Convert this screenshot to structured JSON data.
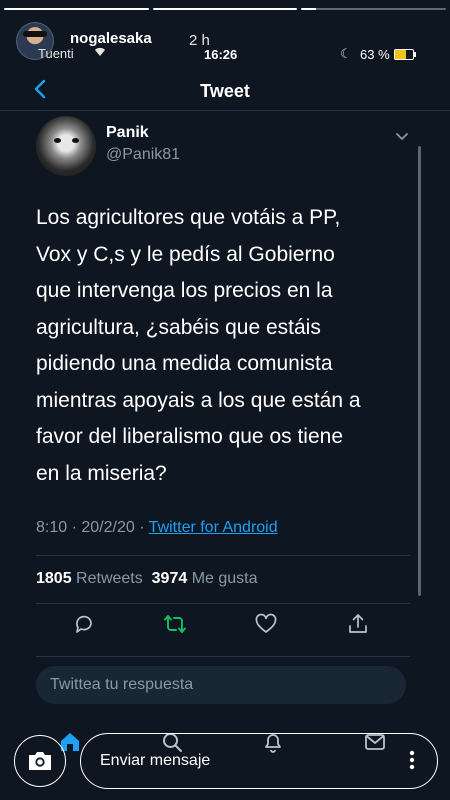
{
  "story": {
    "username": "nogalesaka",
    "time_ago": "2 h",
    "progress": [
      1,
      1,
      0.1
    ]
  },
  "statusbar": {
    "carrier": "Tuenti",
    "time": "16:26",
    "battery": "63 %",
    "battery_level": 0.63,
    "battery_color": "#f2c31b"
  },
  "nav": {
    "title": "Tweet"
  },
  "tweet": {
    "name": "Panik",
    "handle": "@Panik81",
    "text_lines": [
      "Los agricultores que votáis a PP,",
      "Vox y C,s y le pedís al Gobierno",
      "que intervenga los precios en la",
      "agricultura, ¿sabéis que estáis",
      "pidiendo una medida comunista",
      "mientras apoyais a los que están a",
      "favor del liberalismo que os tiene",
      "en la miseria?"
    ],
    "timestamp": "8:10 · 20/2/20 · ",
    "source": "Twitter for Android",
    "retweets_count": "1805",
    "retweets_label": "Retweets",
    "likes_count": "3974",
    "likes_label": "Me gusta"
  },
  "reply": {
    "placeholder": "Twittea tu respuesta"
  },
  "story_footer": {
    "message_placeholder": "Enviar mensaje"
  },
  "colors": {
    "background": "#0e1621",
    "accent": "#1da1f2",
    "retweet_green": "#17bf63",
    "muted": "#8899a6"
  },
  "icons": [
    "back-icon",
    "chevron-down-icon",
    "reply-icon",
    "retweet-icon",
    "like-icon",
    "share-icon",
    "home-icon",
    "search-icon",
    "notifications-icon",
    "messages-icon",
    "camera-icon",
    "more-icon"
  ]
}
